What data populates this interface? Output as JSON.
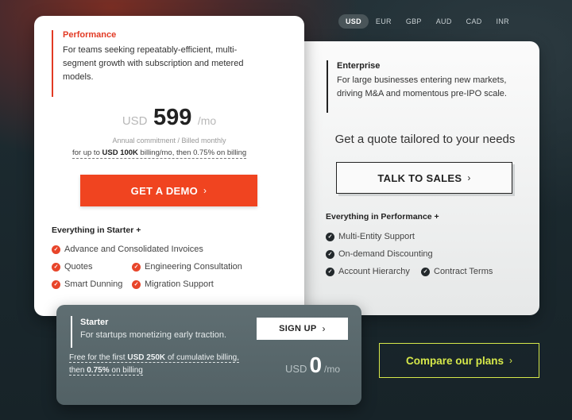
{
  "currencies": [
    "USD",
    "EUR",
    "GBP",
    "AUD",
    "CAD",
    "INR"
  ],
  "selected_currency": "USD",
  "performance": {
    "title": "Performance",
    "description": "For teams seeking repeatably-efficient, multi-segment growth with subscription and metered models.",
    "price_currency": "USD",
    "price": "599",
    "price_period": "/mo",
    "commitment": "Annual commitment / Billed monthly",
    "billing_prefix": "for up to ",
    "billing_bold": "USD 100K",
    "billing_suffix": " billing/mo, then 0.75% on billing",
    "cta": "GET A DEMO",
    "features_heading": "Everything in Starter +",
    "features": [
      "Advance and Consolidated Invoices",
      "Quotes",
      "Engineering Consultation",
      "Smart Dunning",
      "Migration Support"
    ]
  },
  "enterprise": {
    "title": "Enterprise",
    "description": "For large businesses entering new markets, driving M&A and momentous pre-IPO scale.",
    "quote_text": "Get a quote tailored to your needs",
    "cta": "TALK TO SALES",
    "features_heading": "Everything in Performance +",
    "features": [
      "Multi-Entity Support",
      "On-demand Discounting",
      "Account Hierarchy",
      "Contract Terms"
    ]
  },
  "starter": {
    "title": "Starter",
    "description": "For startups monetizing early traction.",
    "cta": "SIGN UP",
    "billing_1": "Free for the first ",
    "billing_bold_1": "USD 250K",
    "billing_2": " of cumulative billing, then ",
    "billing_bold_2": "0.75%",
    "billing_3": " on billing",
    "price_currency": "USD",
    "price": "0",
    "price_period": "/mo"
  },
  "compare_cta": "Compare our plans",
  "colors": {
    "accent_red": "#f04420",
    "compare_yellow": "#d6e84a"
  }
}
